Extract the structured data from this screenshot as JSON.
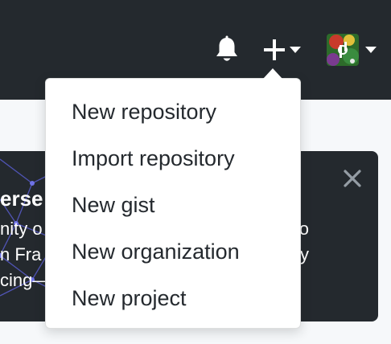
{
  "header": {
    "notifications_icon": "bell-icon",
    "create_icon": "plus-icon",
    "avatar_icon": "user-avatar"
  },
  "create_menu": {
    "items": [
      {
        "label": "New repository"
      },
      {
        "label": "Import repository"
      },
      {
        "label": "New gist"
      },
      {
        "label": "New organization"
      },
      {
        "label": "New project"
      }
    ]
  },
  "banner": {
    "title_fragment": "erse c",
    "lines": [
      "nity o",
      "n Fra",
      "cing—"
    ],
    "right_lines": [
      "o",
      "y"
    ],
    "close_icon": "close-icon"
  },
  "colors": {
    "header_bg": "#24292e",
    "menu_text": "#24292e",
    "page_bg": "#f6f8fa"
  }
}
